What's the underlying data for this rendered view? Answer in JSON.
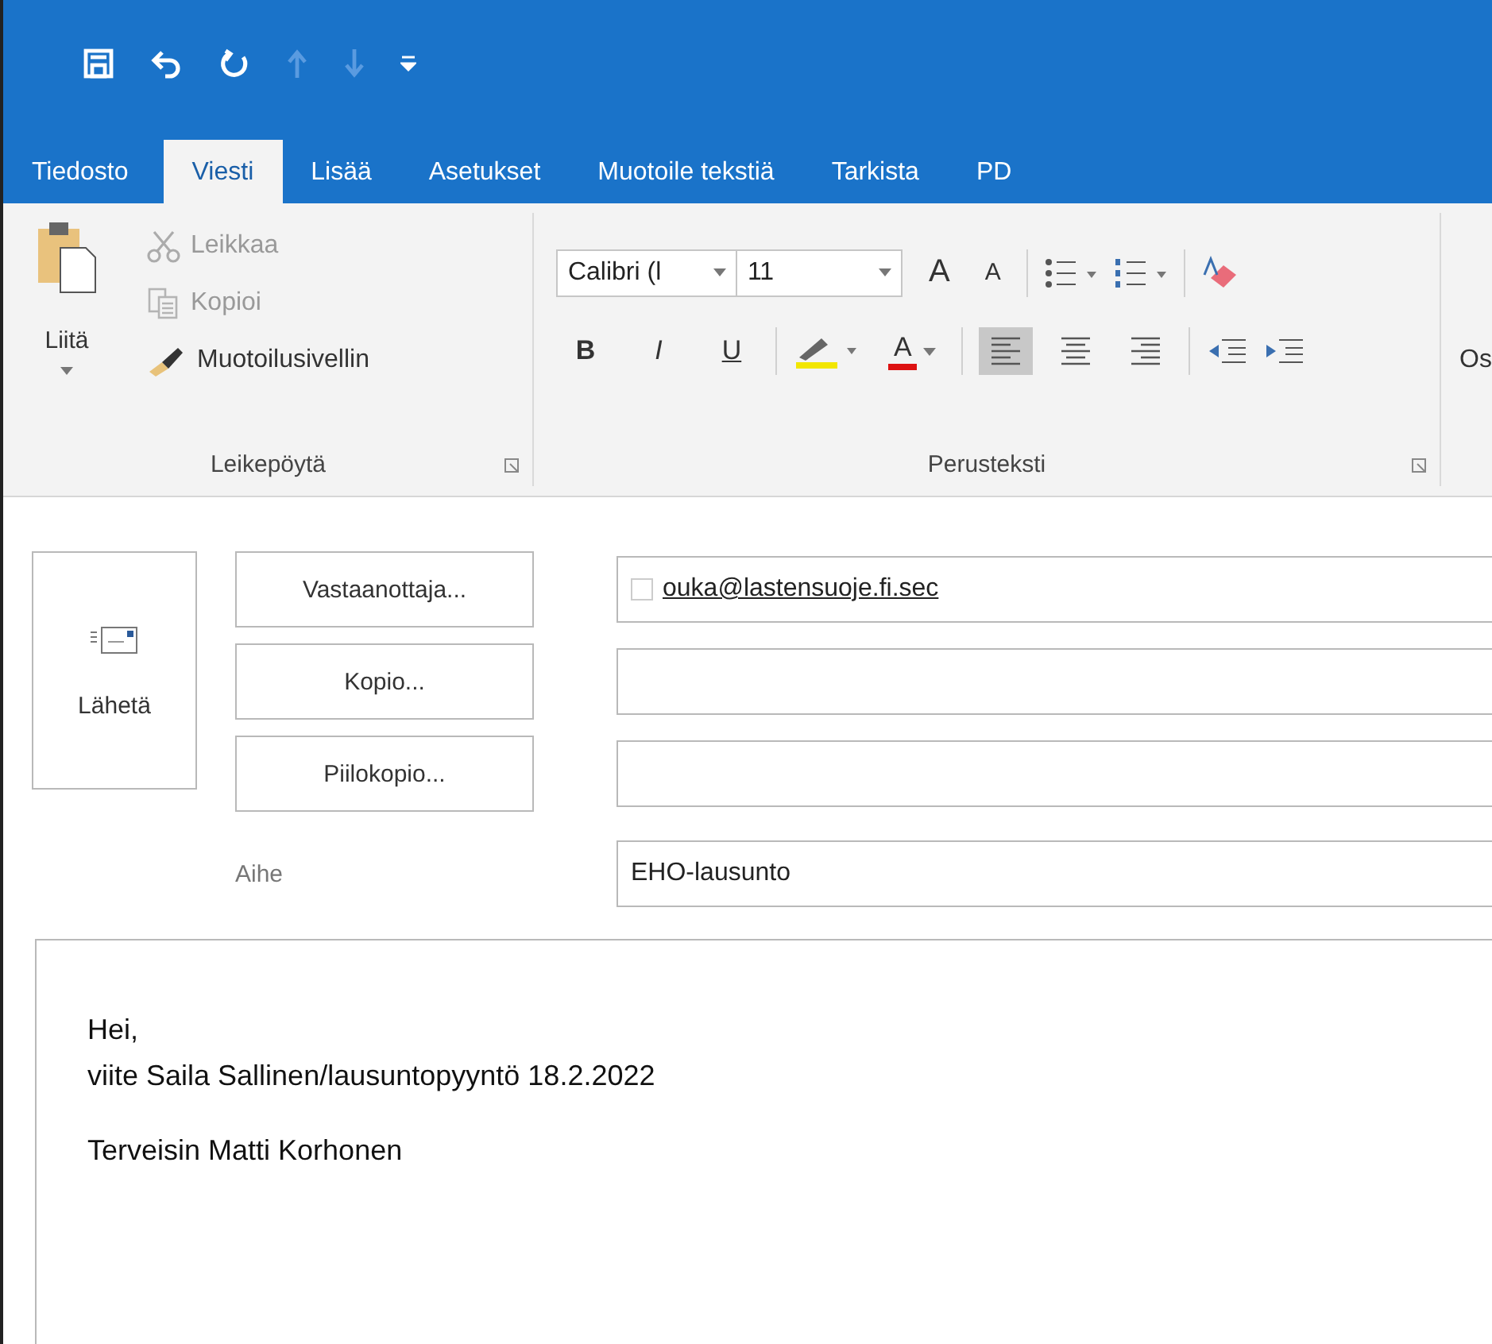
{
  "quick_access": [
    {
      "kind": "save",
      "disabled": false
    },
    {
      "kind": "undo",
      "disabled": false
    },
    {
      "kind": "redo",
      "disabled": false
    },
    {
      "kind": "up",
      "disabled": true
    },
    {
      "kind": "down",
      "disabled": true
    },
    {
      "kind": "customize",
      "disabled": false
    }
  ],
  "tabs": [
    {
      "label": "Tiedosto",
      "selected": false
    },
    {
      "label": "Viesti",
      "selected": true
    },
    {
      "label": "Lisää",
      "selected": false
    },
    {
      "label": "Asetukset",
      "selected": false
    },
    {
      "label": "Muotoile tekstiä",
      "selected": false
    },
    {
      "label": "Tarkista",
      "selected": false
    },
    {
      "label": "PD",
      "selected": false
    }
  ],
  "clipboard": {
    "paste": "Liitä",
    "items": [
      {
        "kind": "cut",
        "label": "Leikkaa",
        "disabled": true
      },
      {
        "kind": "copy",
        "label": "Kopioi",
        "disabled": true
      },
      {
        "kind": "brush",
        "label": "Muotoilusivellin",
        "disabled": false
      }
    ],
    "group": "Leikepöytä"
  },
  "basic_text": {
    "font_name": "Calibri (l",
    "font_size": "11",
    "grow": "A",
    "shrink": "A",
    "styles": [
      {
        "kind": "bold",
        "label": "B"
      },
      {
        "kind": "italic",
        "label": "I"
      },
      {
        "kind": "underline",
        "label": "U"
      }
    ],
    "font_color": "A",
    "align": [
      {
        "kind": "left",
        "selected": true
      },
      {
        "kind": "center",
        "selected": false
      },
      {
        "kind": "right",
        "selected": false
      }
    ],
    "group": "Perusteksti"
  },
  "next_group": "Os",
  "compose": {
    "send": "Lähetä",
    "address_rows": [
      {
        "button": "Vastaanottaja...",
        "value": "ouka@lastensuoje.fi.sec"
      },
      {
        "button": "Kopio..."
      },
      {
        "button": "Piilokopio..."
      }
    ],
    "subject": {
      "label": "Aihe",
      "value": "EHO-lausunto"
    },
    "body": [
      [
        "Hei,",
        "viite Saila Sallinen/lausuntopyyntö 18.2.2022"
      ],
      [
        "Terveisin Matti Korhonen"
      ]
    ]
  }
}
